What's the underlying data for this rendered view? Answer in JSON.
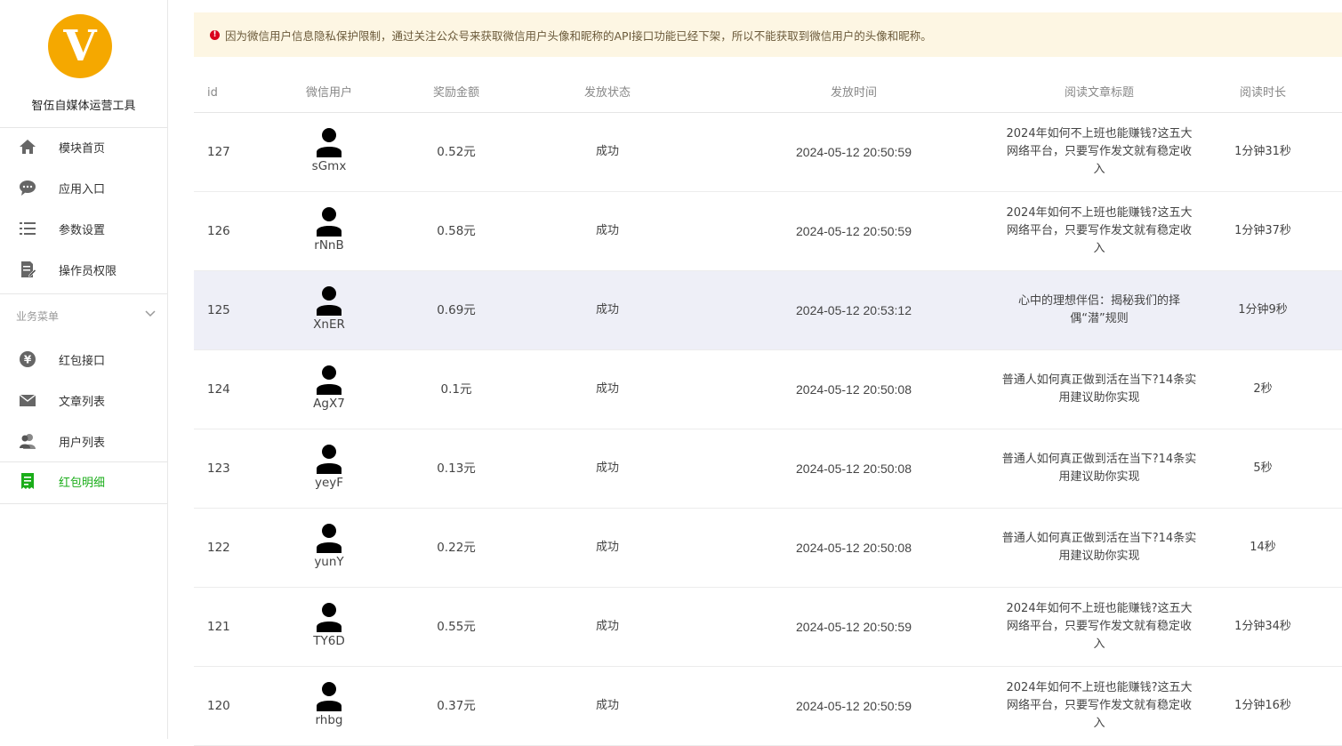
{
  "app": {
    "logo_letter": "V",
    "name": "智伍自媒体运营工具"
  },
  "sidebar": {
    "items": [
      {
        "label": "模块首页",
        "icon": "home-icon"
      },
      {
        "label": "应用入口",
        "icon": "chat-icon"
      },
      {
        "label": "参数设置",
        "icon": "list-settings-icon"
      },
      {
        "label": "操作员权限",
        "icon": "edit-document-icon"
      }
    ],
    "section": {
      "title": "业务菜单"
    },
    "section_items": [
      {
        "label": "红包接口",
        "icon": "yen-icon"
      },
      {
        "label": "文章列表",
        "icon": "mail-icon"
      },
      {
        "label": "用户列表",
        "icon": "users-icon"
      },
      {
        "label": "红包明细",
        "icon": "receipt-icon",
        "active": true
      }
    ]
  },
  "notice": {
    "text": "因为微信用户信息隐私保护限制，通过关注公众号来获取微信用户头像和昵称的API接口功能已经下架，所以不能获取到微信用户的头像和昵称。"
  },
  "table": {
    "headers": {
      "id": "id",
      "user": "微信用户",
      "amount": "奖励金额",
      "status": "发放状态",
      "time": "发放时间",
      "title": "阅读文章标题",
      "duration": "阅读时长"
    },
    "rows": [
      {
        "id": "127",
        "user": "sGmx",
        "amount": "0.52元",
        "status": "成功",
        "time": "2024-05-12 20:50:59",
        "title": "2024年如何不上班也能赚钱?这五大网络平台，只要写作发文就有稳定收入",
        "duration": "1分钟31秒"
      },
      {
        "id": "126",
        "user": "rNnB",
        "amount": "0.58元",
        "status": "成功",
        "time": "2024-05-12 20:50:59",
        "title": "2024年如何不上班也能赚钱?这五大网络平台，只要写作发文就有稳定收入",
        "duration": "1分钟37秒"
      },
      {
        "id": "125",
        "user": "XnER",
        "amount": "0.69元",
        "status": "成功",
        "time": "2024-05-12 20:53:12",
        "title": "心中的理想伴侣：揭秘我们的择偶“潜”规则",
        "duration": "1分钟9秒"
      },
      {
        "id": "124",
        "user": "AgX7",
        "amount": "0.1元",
        "status": "成功",
        "time": "2024-05-12 20:50:08",
        "title": "普通人如何真正做到活在当下?14条实用建议助你实现",
        "duration": "2秒"
      },
      {
        "id": "123",
        "user": "yeyF",
        "amount": "0.13元",
        "status": "成功",
        "time": "2024-05-12 20:50:08",
        "title": "普通人如何真正做到活在当下?14条实用建议助你实现",
        "duration": "5秒"
      },
      {
        "id": "122",
        "user": "yunY",
        "amount": "0.22元",
        "status": "成功",
        "time": "2024-05-12 20:50:08",
        "title": "普通人如何真正做到活在当下?14条实用建议助你实现",
        "duration": "14秒"
      },
      {
        "id": "121",
        "user": "TY6D",
        "amount": "0.55元",
        "status": "成功",
        "time": "2024-05-12 20:50:59",
        "title": "2024年如何不上班也能赚钱?这五大网络平台，只要写作发文就有稳定收入",
        "duration": "1分钟34秒"
      },
      {
        "id": "120",
        "user": "rhbg",
        "amount": "0.37元",
        "status": "成功",
        "time": "2024-05-12 20:50:59",
        "title": "2024年如何不上班也能赚钱?这五大网络平台，只要写作发文就有稳定收入",
        "duration": "1分钟16秒"
      }
    ]
  },
  "colors": {
    "accent_green": "#1aad19",
    "logo_orange": "#f5a800",
    "notice_bg": "#fdf6e3",
    "notice_dot": "#d9001b"
  }
}
